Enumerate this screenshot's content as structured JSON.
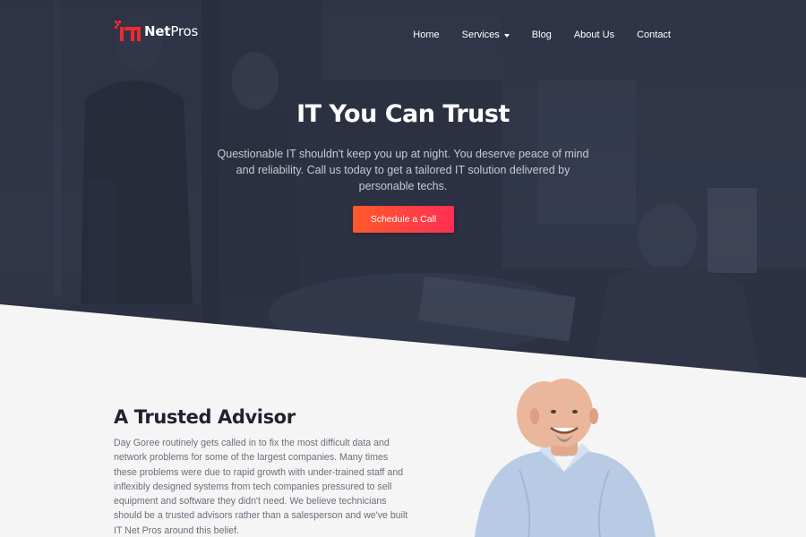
{
  "brand": {
    "logo_mark": "IT",
    "name_bold": "Net",
    "name_light": "Pros",
    "colors": {
      "accent": "#f2292f",
      "hero_bg": "#2c3142",
      "section_bg": "#f5f5f6"
    }
  },
  "nav": {
    "items": [
      {
        "label": "Home"
      },
      {
        "label": "Services",
        "icon": "caret-down-icon"
      },
      {
        "label": "Blog"
      },
      {
        "label": "About Us"
      },
      {
        "label": "Contact"
      }
    ]
  },
  "hero": {
    "title": "IT You Can Trust",
    "subtitle": "Questionable IT shouldn't keep you up at night. You deserve peace of mind and reliability. Call us today to get a tailored IT solution delivered by personable techs.",
    "cta_label": "Schedule a Call",
    "cta_gradient": [
      "#ff5a2a",
      "#ff2e55"
    ]
  },
  "advisor": {
    "heading": "A Trusted Advisor",
    "body": "Day Goree routinely gets called in to fix the most difficult data and network problems for some of the largest companies. Many times these problems were due to rapid growth with under-trained staff and inflexibly designed systems from tech companies pressured to sell equipment and software they didn't need. We believe technicians should be a trusted advisors rather than a salesperson and we've built IT Net Pros around this belief."
  }
}
